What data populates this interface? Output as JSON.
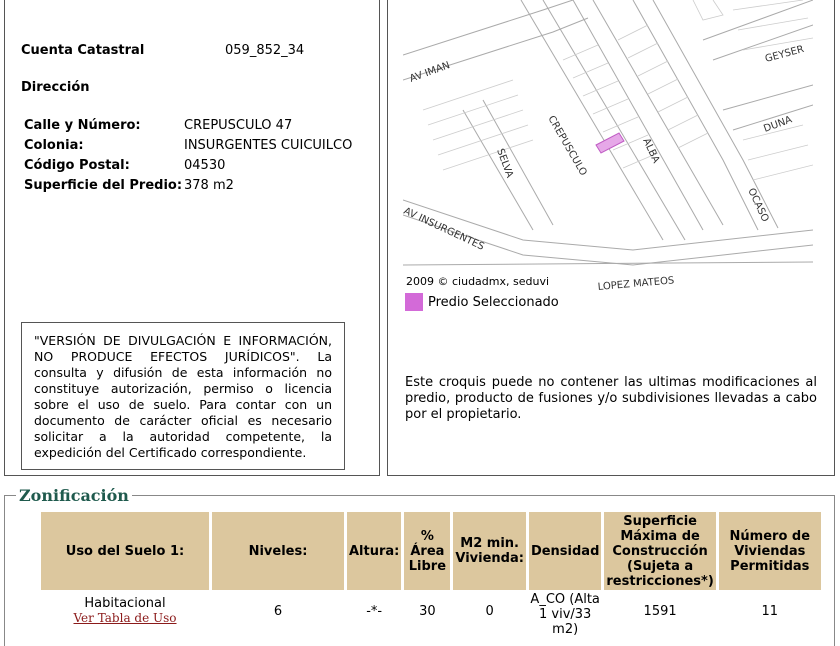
{
  "cadastral": {
    "account_label": "Cuenta Catastral",
    "account_value": "059_852_34",
    "address_heading": "Dirección",
    "street_label": "Calle y Número:",
    "street_value": "CREPUSCULO 47",
    "colonia_label": "Colonia:",
    "colonia_value": "INSURGENTES CUICUILCO",
    "postal_label": "Código Postal:",
    "postal_value": "04530",
    "area_label": "Superficie del Predio:",
    "area_value": "378 m2"
  },
  "disclaimer": "\"VERSIÓN DE DIVULGACIÓN E INFORMACIÓN, NO PRODUCE EFECTOS JURÍDICOS\". La consulta y difusión de esta información no constituye autorización, permiso o licencia sobre el uso de suelo. Para contar con un documento de carácter oficial es necesario solicitar a la autoridad competente, la expedición del Certificado correspondiente.",
  "map": {
    "streets": [
      "AV IMAN",
      "GEYSER",
      "DUNA",
      "CREPUSCULO",
      "ALBA",
      "SELVA",
      "OCASO",
      "AV INSURGENTES",
      "LOPEZ MATEOS"
    ],
    "credit": "2009 © ciudadmx, seduvi",
    "legend_label": "Predio Seleccionado",
    "legend_color": "#d36ad8",
    "note": "Este croquis puede no contener las ultimas modificaciones al predio, producto de fusiones y/o subdivisiones llevadas a cabo por el propietario."
  },
  "zonificacion": {
    "title": "Zonificación",
    "headers": [
      "Uso del Suelo 1:",
      "Niveles:",
      "Altura:",
      "% Área Libre",
      "M2 min. Vivienda:",
      "Densidad",
      "Superficie Máxima de Construcción (Sujeta a restricciones*)",
      "Número de Viviendas Permitidas"
    ],
    "row": {
      "uso": "Habitacional",
      "uso_link": "Ver Tabla de Uso",
      "niveles": "6",
      "altura": "-*-",
      "area_libre": "30",
      "m2_min": "0",
      "densidad": "A_CO (Alta 1 viv/33 m2)",
      "superficie": "1591",
      "viviendas": "11"
    }
  }
}
